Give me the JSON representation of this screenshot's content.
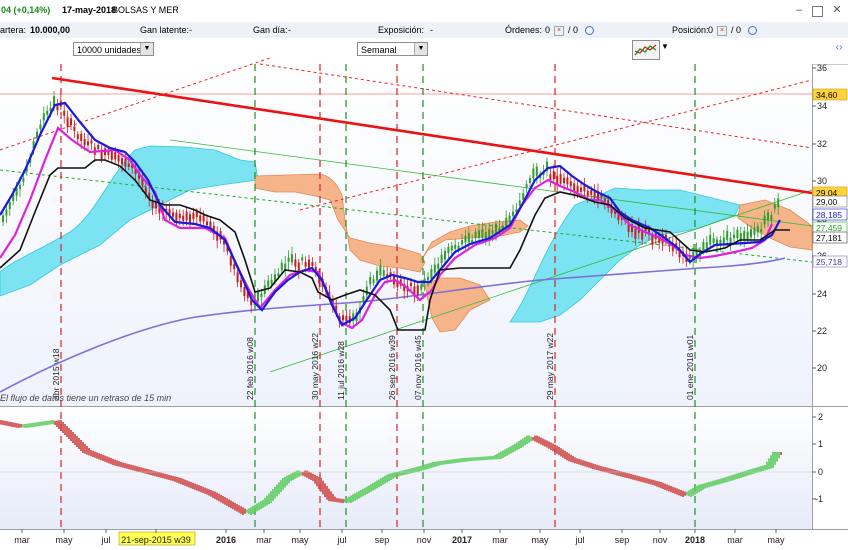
{
  "titlebar": {
    "change": "04 (+0,14%)",
    "date": "17-may-2018",
    "instrument": "BOLSAS Y MER",
    "min_icon": "minimize-icon",
    "max_icon": "maximize-icon",
    "close_icon": "close-icon"
  },
  "stats": {
    "cartera_label": "artera:",
    "cartera_value": "10.000,00",
    "ganlatente_label": "Gan latente:",
    "ganlatente_value": "-",
    "gandia_label": "Gan día:",
    "gandia_value": "-",
    "exposicion_label": "Exposición:",
    "exposicion_value": "-",
    "ordenes_label": "Órdenes:",
    "ordenes_value": "0",
    "ordenes_sep": "/ 0",
    "posicion_label": "Posición:",
    "posicion_value": "0",
    "posicion_sep": "/ 0"
  },
  "toolbar": {
    "quantity_value": "10000 unidades",
    "period_value": "Semanal"
  },
  "colors": {
    "trendline": "#ee1111",
    "ma_fast": "#1a1adc",
    "ma_mid": "#dd22dd",
    "ma_slow": "#111111",
    "ma_long": "#7a70d8",
    "cloud_bull": "#7be3f2",
    "cloud_bear": "#f6b48a",
    "candle_up": "#2e9e2e",
    "candle_down": "#c81e1e",
    "osc_pos": "#5ecb5e",
    "osc_neg": "#d04a4a"
  },
  "chart": {
    "notice": "El flujo de datos tiene un retraso de 15 min",
    "y_ticks": [
      "36",
      "34",
      "32",
      "30",
      "28",
      "26",
      "24",
      "22",
      "20"
    ],
    "price_tags": [
      "34,60",
      "29,04",
      "29,00",
      "28,185",
      "27,459",
      "27,181",
      "25,718"
    ],
    "vlines": [
      {
        "label": "abr 2015 w18",
        "color": "red"
      },
      {
        "label": "22 feb 2016 w08",
        "color": "green"
      },
      {
        "label": "30 may 2016 w22",
        "color": "red"
      },
      {
        "label": "11 jul 2016 w28",
        "color": "green"
      },
      {
        "label": "26 sep 2016 w39",
        "color": "red"
      },
      {
        "label": "07 nov 2016 w45",
        "color": "green"
      },
      {
        "label": "29 may 2017 w22",
        "color": "red"
      },
      {
        "label": "01 ene 2018 w01",
        "color": "green"
      }
    ],
    "osc_ticks": [
      "2",
      "1",
      "0",
      "-1"
    ],
    "x_labels": [
      "mar",
      "may",
      "jul",
      "21-sep-2015 w39",
      "2016",
      "mar",
      "may",
      "jul",
      "sep",
      "nov",
      "2017",
      "mar",
      "may",
      "jul",
      "sep",
      "nov",
      "2018",
      "mar",
      "may"
    ]
  }
}
